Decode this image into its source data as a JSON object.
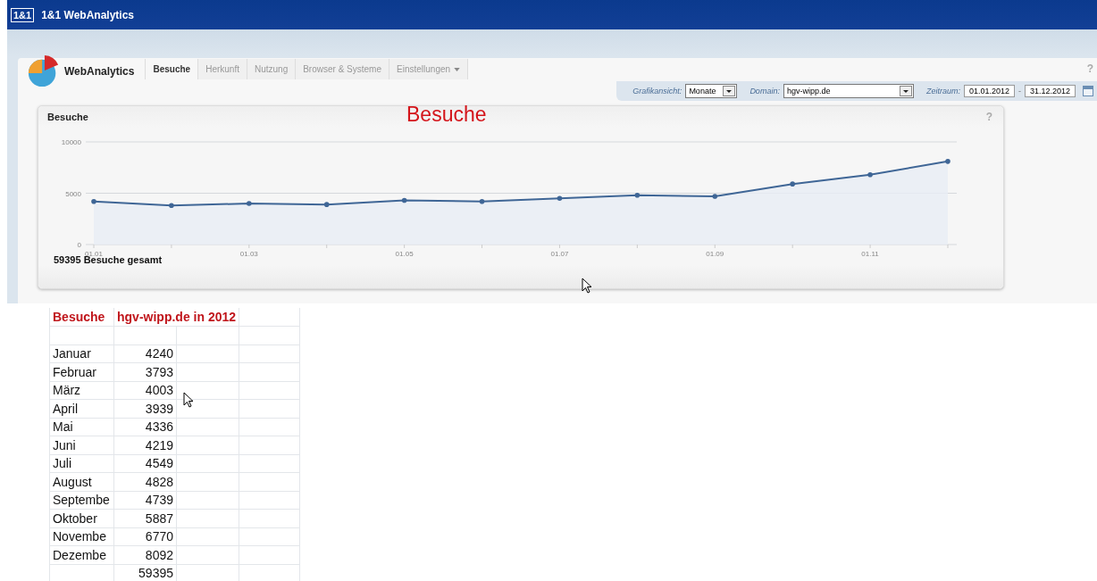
{
  "app_bar": {
    "logo": "1&1",
    "title": "1&1 WebAnalytics"
  },
  "nav": {
    "brand": "WebAnalytics",
    "help": "?",
    "tabs": [
      {
        "label": "Besuche",
        "selected": true,
        "menu": false
      },
      {
        "label": "Herkunft",
        "selected": false,
        "menu": false
      },
      {
        "label": "Nutzung",
        "selected": false,
        "menu": false
      },
      {
        "label": "Browser & Systeme",
        "selected": false,
        "menu": false
      },
      {
        "label": "Einstellungen",
        "selected": false,
        "menu": true
      }
    ]
  },
  "filters": [
    {
      "kind": "select",
      "label": "Grafikansicht:",
      "value": "Monate"
    },
    {
      "kind": "select",
      "label": "Domain:",
      "value": "hgv-wipp.de"
    },
    {
      "kind": "daterange",
      "label": "Zeitraum:",
      "from": "01.01.2012",
      "separator": "-",
      "to": "31.12.2012"
    }
  ],
  "chart_card": {
    "title": "Besuche",
    "overlay_title": "Besuche",
    "help": "?",
    "total": "59395 Besuche gesamt",
    "chart_data": {
      "type": "area",
      "categories": [
        "01.01",
        null,
        "01.03",
        null,
        "01.05",
        null,
        "01.07",
        null,
        "01.09",
        null,
        "01.11",
        null
      ],
      "series": [
        {
          "color": "#3f6696",
          "values": [
            4200,
            3800,
            4000,
            3900,
            4300,
            4200,
            4500,
            4800,
            4700,
            5900,
            6800,
            8100
          ]
        }
      ],
      "ylim": [
        0,
        10000
      ],
      "yticks": [
        0,
        5000,
        10000
      ]
    }
  },
  "sheet": {
    "header": [
      "Besuche",
      "hgv-wipp.de in 2012"
    ],
    "rows": [
      {
        "month": "Januar",
        "value": "4240"
      },
      {
        "month": "Februar",
        "value": "3793"
      },
      {
        "month": "März",
        "value": "4003"
      },
      {
        "month": "April",
        "value": "3939"
      },
      {
        "month": "Mai",
        "value": "4336"
      },
      {
        "month": "Juni",
        "value": "4219"
      },
      {
        "month": "Juli",
        "value": "4549"
      },
      {
        "month": "August",
        "value": "4828"
      },
      {
        "month": "Septembe",
        "value": "4739"
      },
      {
        "month": "Oktober",
        "value": "5887"
      },
      {
        "month": "Novembe",
        "value": "6770"
      },
      {
        "month": "Dezembe",
        "value": "8092"
      }
    ],
    "total": "59395"
  }
}
